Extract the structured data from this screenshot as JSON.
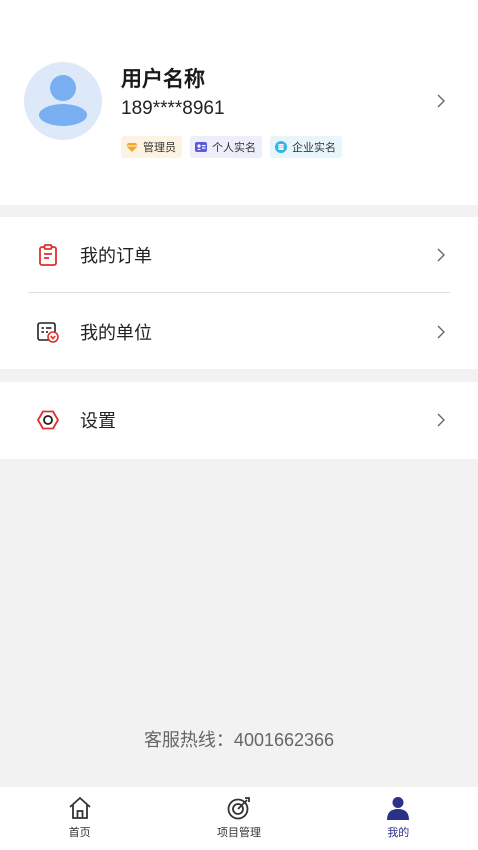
{
  "profile": {
    "name": "用户名称",
    "phone": "189****8961",
    "badges": {
      "admin": "管理员",
      "personal": "个人实名",
      "enterprise": "企业实名"
    }
  },
  "menu": {
    "orders": "我的订单",
    "units": "我的单位",
    "settings": "设置"
  },
  "hotline": "客服热线：4001662366",
  "tabs": {
    "home": "首页",
    "projects": "项目管理",
    "mine": "我的"
  },
  "colors": {
    "accent": "#2a3186",
    "icon_red": "#e0302a",
    "badge_orange": "#f5a623",
    "badge_purple": "#5b5bd6",
    "badge_cyan": "#31b6e8"
  }
}
